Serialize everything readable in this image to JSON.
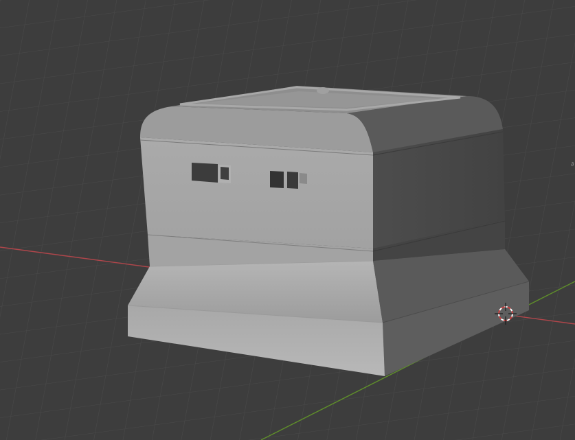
{
  "viewport": {
    "background": "#3d3d3d",
    "grid_color": "#4a4a4a",
    "x_axis_color": "#b0464b",
    "y_axis_color": "#5f8f2a",
    "cursor_colors": [
      "#c94040",
      "#ffffff"
    ]
  },
  "object": {
    "name": "",
    "base_front_color": "#b3b3b3",
    "base_side_color": "#5b5b5b",
    "body_front_color": "#a4a4a4",
    "body_side_color": "#474747",
    "top_color": "#8f8f8f"
  },
  "icons": {
    "cursor": "3d-cursor-icon"
  }
}
